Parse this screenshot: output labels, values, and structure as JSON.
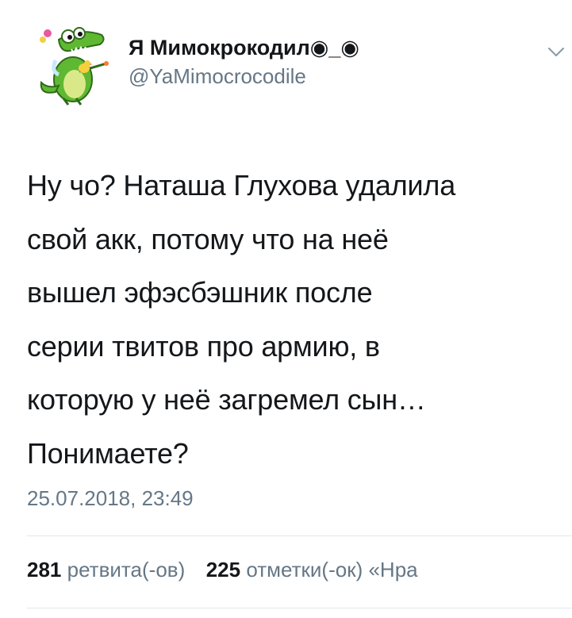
{
  "author": {
    "display_name": "Я Мимокрокодил◉_◉",
    "username": "@YaMimocrocodile"
  },
  "icons": {
    "avatar": "crocodile-avatar-icon",
    "menu": "chevron-down-icon"
  },
  "tweet": {
    "text": "Ну чо? Наташа Глухова удалила\nсвой акк, потому что на неё\nвышел эфэсбэшник после\nсерии твитов про армию, в\nкоторую у неё загремел сын…\nПонимаете?",
    "timestamp": "25.07.2018, 23:49"
  },
  "stats": {
    "retweets_count": "281",
    "retweets_label": "ретвита(-ов)",
    "likes_count": "225",
    "likes_label": "отметки(-ок) «Нра"
  },
  "colors": {
    "text": "#14171a",
    "secondary": "#657786",
    "divider": "#e1e8ed",
    "avatar_green": "#5fb832"
  }
}
